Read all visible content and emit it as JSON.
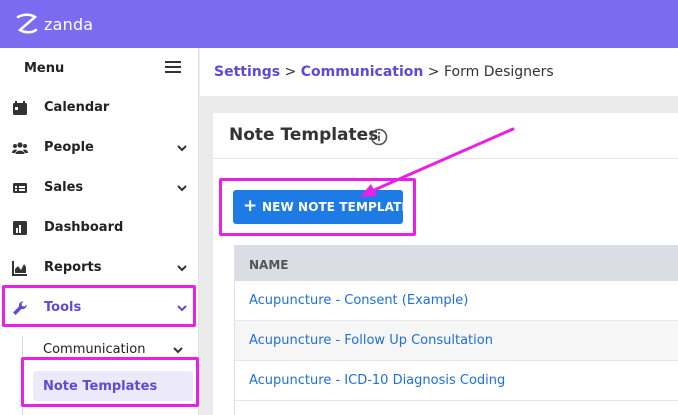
{
  "brand": {
    "name": "zanda",
    "color": "#7b6bf0"
  },
  "sidebar": {
    "menu_title": "Menu",
    "items": [
      {
        "label": "Calendar",
        "icon": "calendar-icon"
      },
      {
        "label": "People",
        "icon": "people-icon"
      },
      {
        "label": "Sales",
        "icon": "sales-icon"
      },
      {
        "label": "Dashboard",
        "icon": "dashboard-icon"
      },
      {
        "label": "Reports",
        "icon": "reports-icon"
      },
      {
        "label": "Tools",
        "icon": "wrench-icon"
      }
    ],
    "subitems": [
      {
        "label": "Communication"
      },
      {
        "label": "Note Templates"
      }
    ]
  },
  "breadcrumb": {
    "part1": "Settings",
    "sep1": " > ",
    "part2": "Communication",
    "sep2": " > ",
    "part3": "Form Designers"
  },
  "panel": {
    "title": "Note Templates",
    "new_button_label": "NEW NOTE TEMPLATE",
    "table": {
      "header": "NAME",
      "rows": [
        "Acupuncture - Consent (Example)",
        "Acupuncture - Follow Up Consultation",
        "Acupuncture - ICD-10 Diagnosis Coding"
      ]
    }
  },
  "colors": {
    "highlight": "#e820e8",
    "primary_button": "#1e7be6",
    "active_text": "#5b4bd6",
    "link": "#1e6fd9"
  }
}
